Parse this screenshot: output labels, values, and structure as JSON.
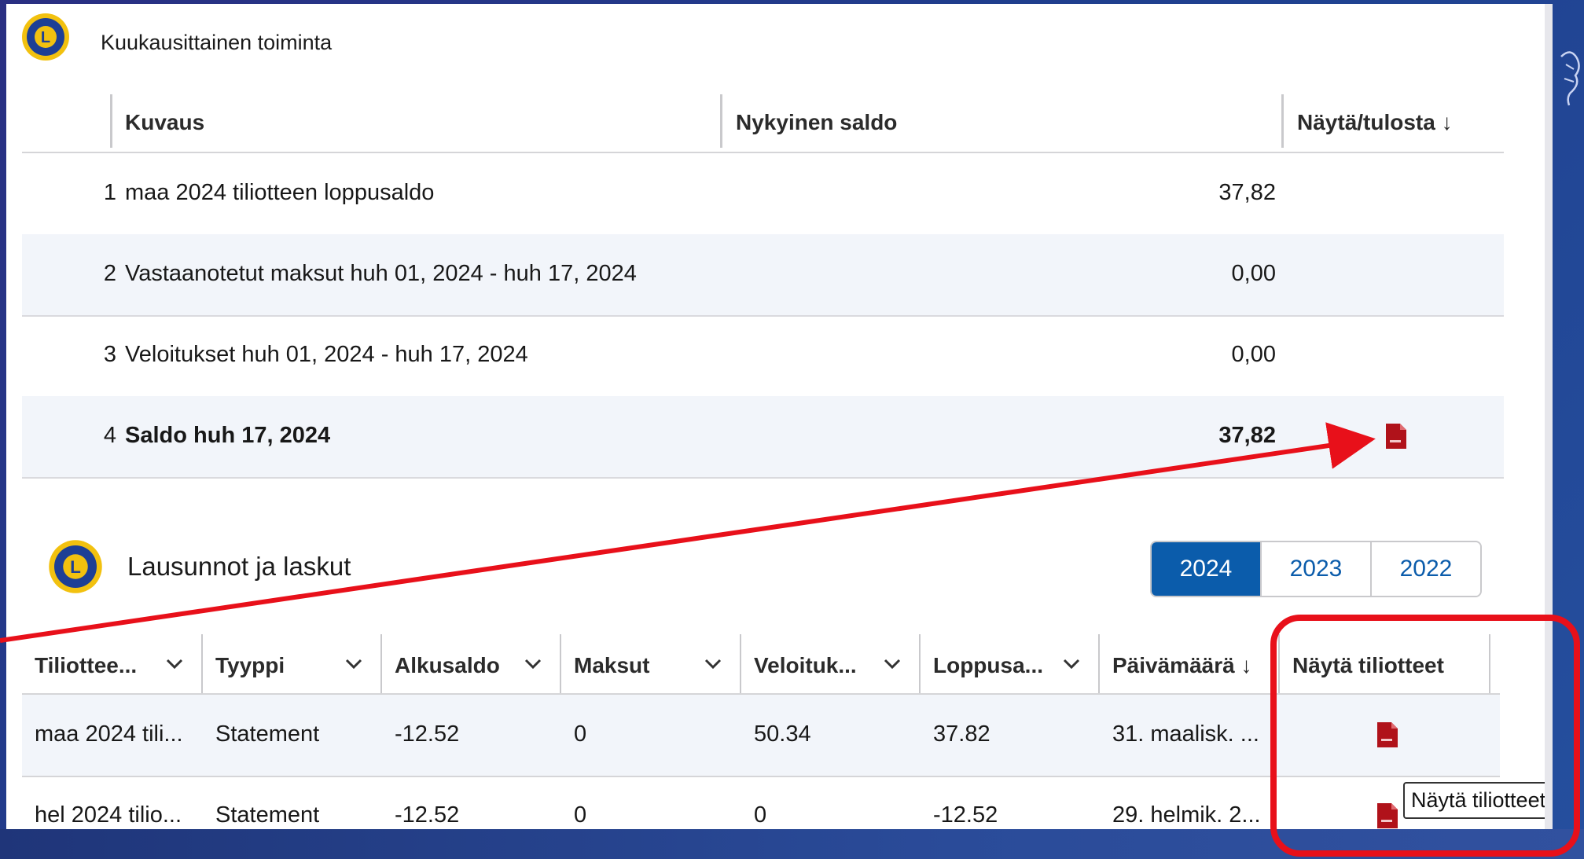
{
  "section1": {
    "title": "Kuukausittainen toiminta",
    "columns": {
      "description": "Kuvaus",
      "balance": "Nykyinen saldo",
      "view": "Näytä/tulosta ↓"
    },
    "rows": [
      {
        "num": "1",
        "desc": "maa 2024 tiliotteen loppusaldo",
        "balance": "37,82"
      },
      {
        "num": "2",
        "desc": "Vastaanotetut maksut huh 01, 2024 - huh 17, 2024",
        "balance": "0,00"
      },
      {
        "num": "3",
        "desc": "Veloitukset huh 01, 2024 - huh 17, 2024",
        "balance": "0,00"
      },
      {
        "num": "4",
        "desc": "Saldo huh 17, 2024",
        "balance": "37,82"
      }
    ]
  },
  "section2": {
    "title": "Lausunnot ja laskut",
    "years": [
      "2024",
      "2023",
      "2022"
    ],
    "selected_year": "2024",
    "columns": [
      "Tiliottee...",
      "Tyyppi",
      "Alkusaldo",
      "Maksut",
      "Veloituk...",
      "Loppusa...",
      "Päivämäärä ↓",
      "Näytä tiliotteet"
    ],
    "rows": [
      {
        "statement": "maa 2024 tili...",
        "type": "Statement",
        "opening": "-12.52",
        "payments": "0",
        "charges": "50.34",
        "closing": "37.82",
        "date": "31. maalisk. ..."
      },
      {
        "statement": "hel 2024 tilio...",
        "type": "Statement",
        "opening": "-12.52",
        "payments": "0",
        "charges": "0",
        "closing": "-12.52",
        "date": "29. helmik. 2..."
      }
    ],
    "tooltip": "Näytä tiliotteet"
  },
  "icons": {
    "logo": "lions-logo-icon",
    "pdf": "pdf-file-icon",
    "chevron": "chevron-down-icon"
  },
  "colors": {
    "accent": "#0b5cab",
    "annotation": "#e8101a",
    "pdf": "#b0121a"
  }
}
